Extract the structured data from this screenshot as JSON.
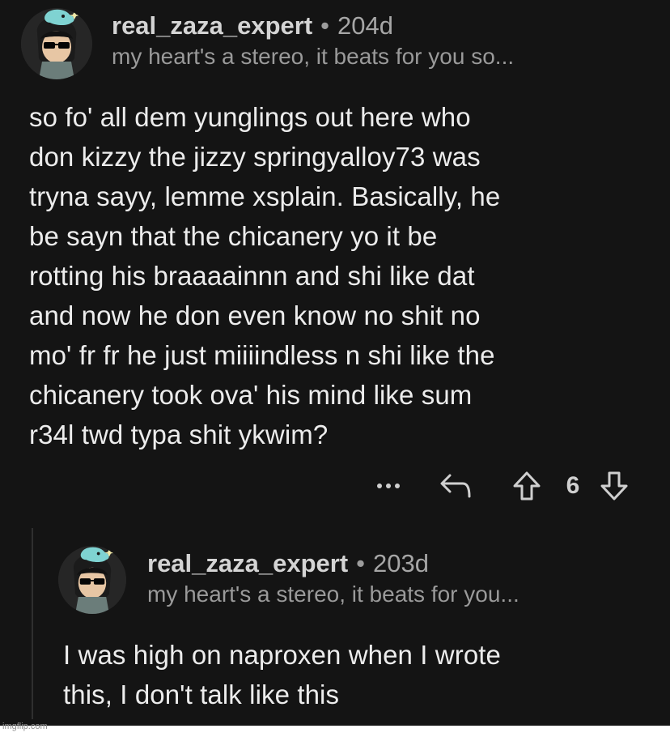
{
  "thread": {
    "comment": {
      "author": "real_zaza_expert",
      "separator": "•",
      "age": "204d",
      "flair": "my heart's a stereo, it beats for you so...",
      "body_lines": [
        "so fo' all dem yunglings out here who",
        "don kizzy the jizzy springyalloy73 was",
        "tryna sayy, lemme xsplain. Basically, he",
        "be sayn that the chicanery yo it be",
        "rotting his braaaainnn and shi like dat",
        "and now he don even know no shit no",
        "mo' fr fr he just miiiindless n shi like the",
        "chicanery took ova' his mind like sum",
        "r34l twd typa shit ykwim?"
      ],
      "actions": {
        "more_icon": "more-dots-icon",
        "reply_icon": "reply-arrow-icon",
        "upvote_icon": "upvote-arrow-icon",
        "score": "6",
        "downvote_icon": "downvote-arrow-icon"
      }
    },
    "reply": {
      "author": "real_zaza_expert",
      "separator": "•",
      "age": "203d",
      "flair": "my heart's a stereo, it beats for you...",
      "body_lines": [
        "I was high on naproxen when I wrote",
        "this, I don't talk like this"
      ]
    },
    "colors": {
      "background": "#141414",
      "text": "#ececec",
      "meta": "#a6a6a6",
      "avatar_bg": "#2a2a2a",
      "accent_teal": "#7fd3d2"
    }
  },
  "watermark": "imgflip.com"
}
